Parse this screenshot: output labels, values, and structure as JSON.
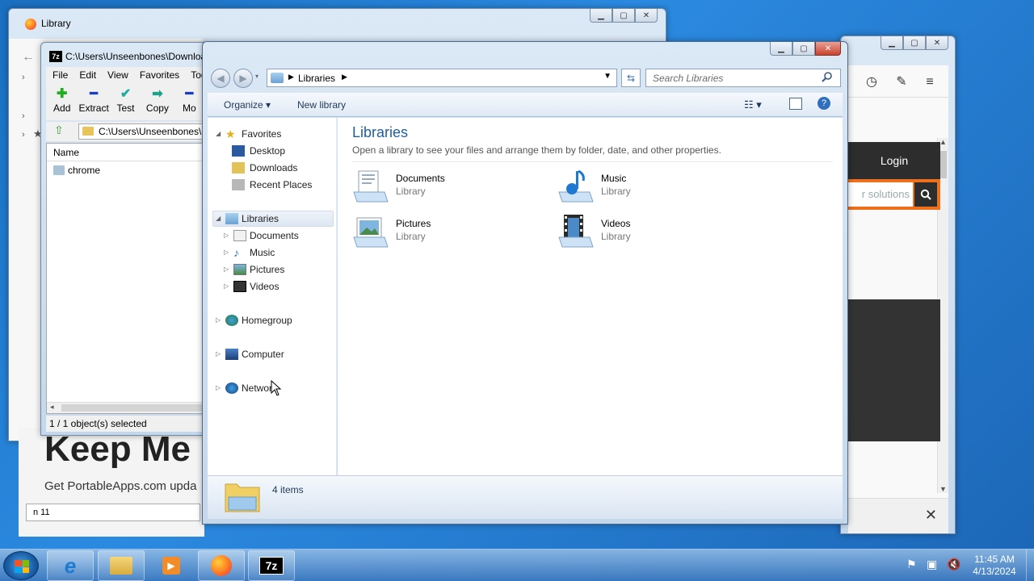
{
  "ff_library": {
    "title": "Library"
  },
  "firefox_browser": {
    "login": "Login",
    "search_placeholder": "r solutions"
  },
  "portableapps": {
    "headline": "Keep Me",
    "tagline": "Get PortableApps.com upda",
    "find_value": "n 11"
  },
  "sevenzip": {
    "title": "C:\\Users\\Unseenbones\\Downloa",
    "menu": [
      "File",
      "Edit",
      "View",
      "Favorites",
      "Too"
    ],
    "toolbar": [
      "Add",
      "Extract",
      "Test",
      "Copy",
      "Mo"
    ],
    "path": "C:\\Users\\Unseenbones\\De",
    "column_name": "Name",
    "rows": [
      "chrome"
    ],
    "status": "1 / 1 object(s) selected"
  },
  "explorer": {
    "breadcrumb": "Libraries",
    "search_placeholder": "Search Libraries",
    "commands": {
      "organize": "Organize",
      "new_library": "New library"
    },
    "nav": {
      "favorites": "Favorites",
      "desktop": "Desktop",
      "downloads": "Downloads",
      "recent": "Recent Places",
      "libraries": "Libraries",
      "documents": "Documents",
      "music": "Music",
      "pictures": "Pictures",
      "videos": "Videos",
      "homegroup": "Homegroup",
      "computer": "Computer",
      "network": "Network"
    },
    "heading": "Libraries",
    "description": "Open a library to see your files and arrange them by folder, date, and other properties.",
    "items": [
      {
        "name": "Documents",
        "type": "Library"
      },
      {
        "name": "Music",
        "type": "Library"
      },
      {
        "name": "Pictures",
        "type": "Library"
      },
      {
        "name": "Videos",
        "type": "Library"
      }
    ],
    "status": "4 items"
  },
  "taskbar": {
    "time": "11:45 AM",
    "date": "4/13/2024",
    "sevenzip_label": "7z"
  }
}
